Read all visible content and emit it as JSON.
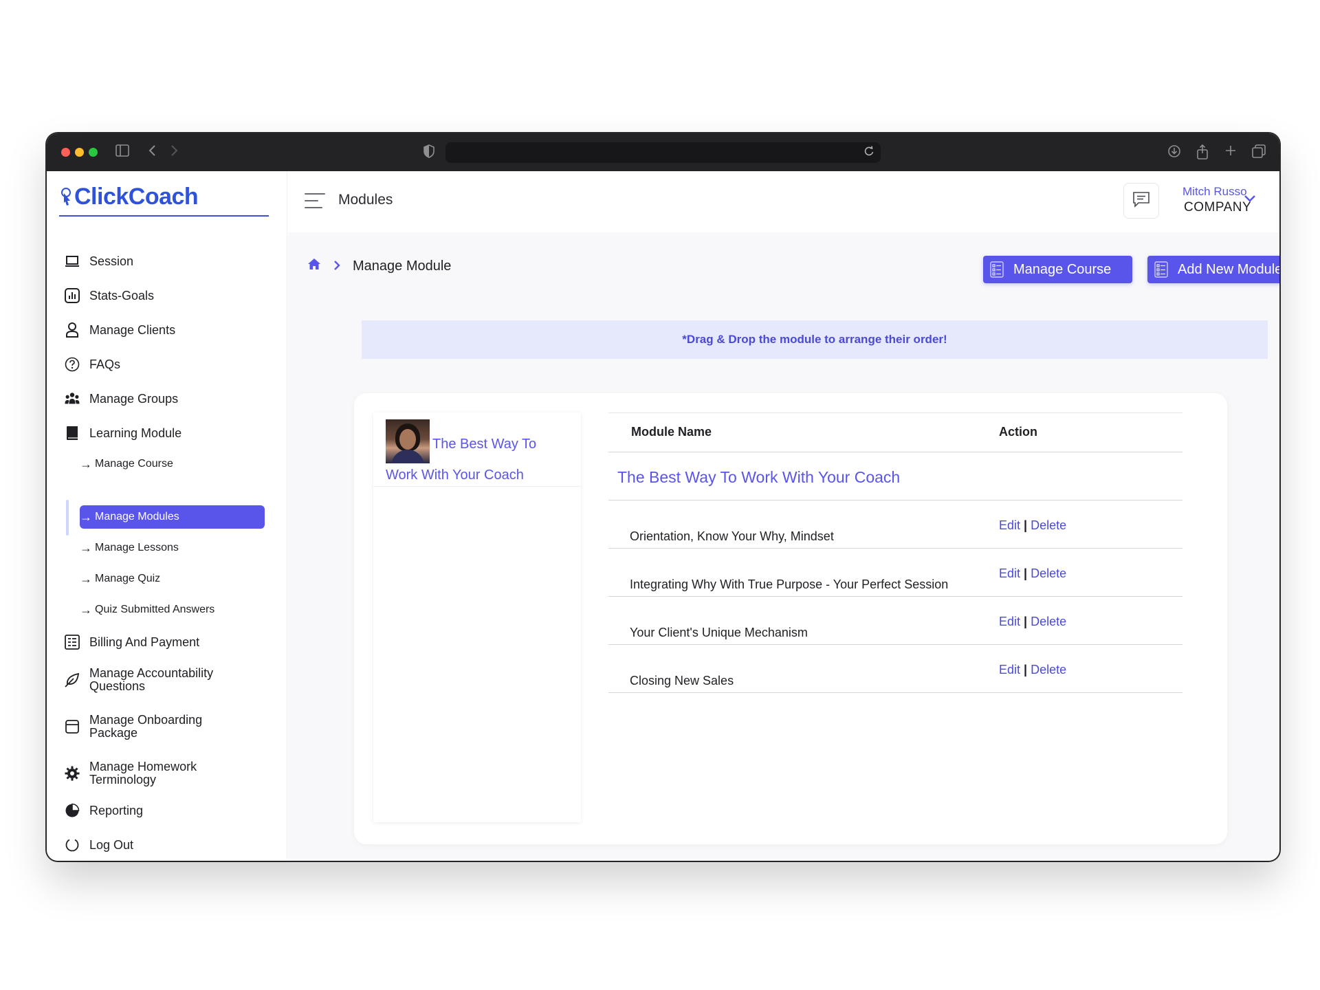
{
  "app": {
    "logo_text": "ClickCoach",
    "page_title": "Modules"
  },
  "user": {
    "name": "Mitch Russo",
    "role": "COMPANY"
  },
  "sidebar": {
    "items": [
      {
        "label": "Session",
        "icon": "laptop-icon"
      },
      {
        "label": "Stats-Goals",
        "icon": "bar-chart-icon"
      },
      {
        "label": "Manage Clients",
        "icon": "user-icon"
      },
      {
        "label": "FAQs",
        "icon": "question-circle-icon"
      },
      {
        "label": "Manage Groups",
        "icon": "users-icon"
      },
      {
        "label": "Learning Module",
        "icon": "book-icon"
      },
      {
        "label": "Billing And Payment",
        "icon": "invoice-icon"
      },
      {
        "label": "Manage Accountability Questions",
        "icon": "leaf-icon"
      },
      {
        "label": "Manage Onboarding Package",
        "icon": "package-icon"
      },
      {
        "label": "Manage Homework Terminology",
        "icon": "gear-icon"
      },
      {
        "label": "Reporting",
        "icon": "pie-chart-icon"
      },
      {
        "label": "Log Out",
        "icon": "logout-icon"
      }
    ],
    "sub_items": [
      {
        "label": "Manage Course"
      },
      {
        "label": "Manage Modules",
        "active": true
      },
      {
        "label": "Manage Lessons"
      },
      {
        "label": "Manage Quiz"
      },
      {
        "label": "Quiz Submitted Answers"
      }
    ]
  },
  "breadcrumb": {
    "current": "Manage Module"
  },
  "buttons": {
    "manage_course": "Manage Course",
    "add_module": "Add New Module"
  },
  "notice": "*Drag & Drop the module to arrange their order!",
  "course": {
    "title": "The Best Way To Work With Your Coach"
  },
  "table": {
    "headers": {
      "name": "Module Name",
      "action": "Action"
    },
    "course_title": "The Best Way To Work With Your Coach",
    "edit_label": "Edit",
    "separator": "|",
    "delete_label": "Delete",
    "rows": [
      {
        "name": "Orientation, Know Your Why, Mindset"
      },
      {
        "name": "Integrating Why With True Purpose - Your Perfect Session"
      },
      {
        "name": "Your Client's Unique Mechanism"
      },
      {
        "name": "Closing New Sales"
      }
    ]
  },
  "colors": {
    "accent": "#5a55ea",
    "brand": "#2f53d8",
    "notice_bg": "#e6e8fb"
  }
}
